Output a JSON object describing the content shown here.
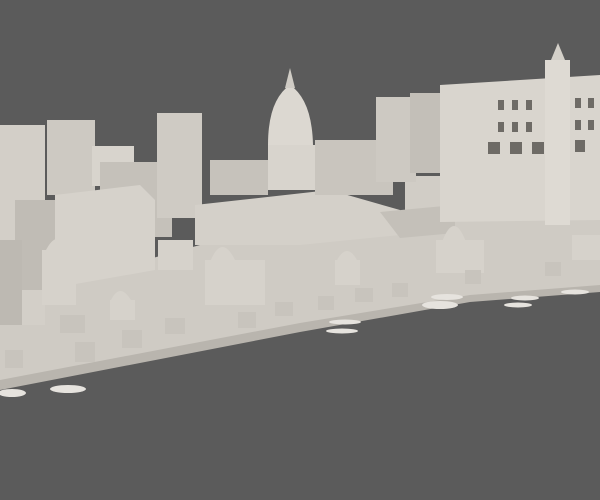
{
  "scene": {
    "subject": "ghat-riverfront-3d-model",
    "colors": {
      "background": "#5b5b5b",
      "ground": "#cfcbc4",
      "ground_shadow": "#b9b5ae",
      "building_light": "#dcd8d1",
      "building_mid": "#c8c4bd",
      "building_dark": "#a9a59f",
      "boat": "#e6e3de"
    }
  }
}
